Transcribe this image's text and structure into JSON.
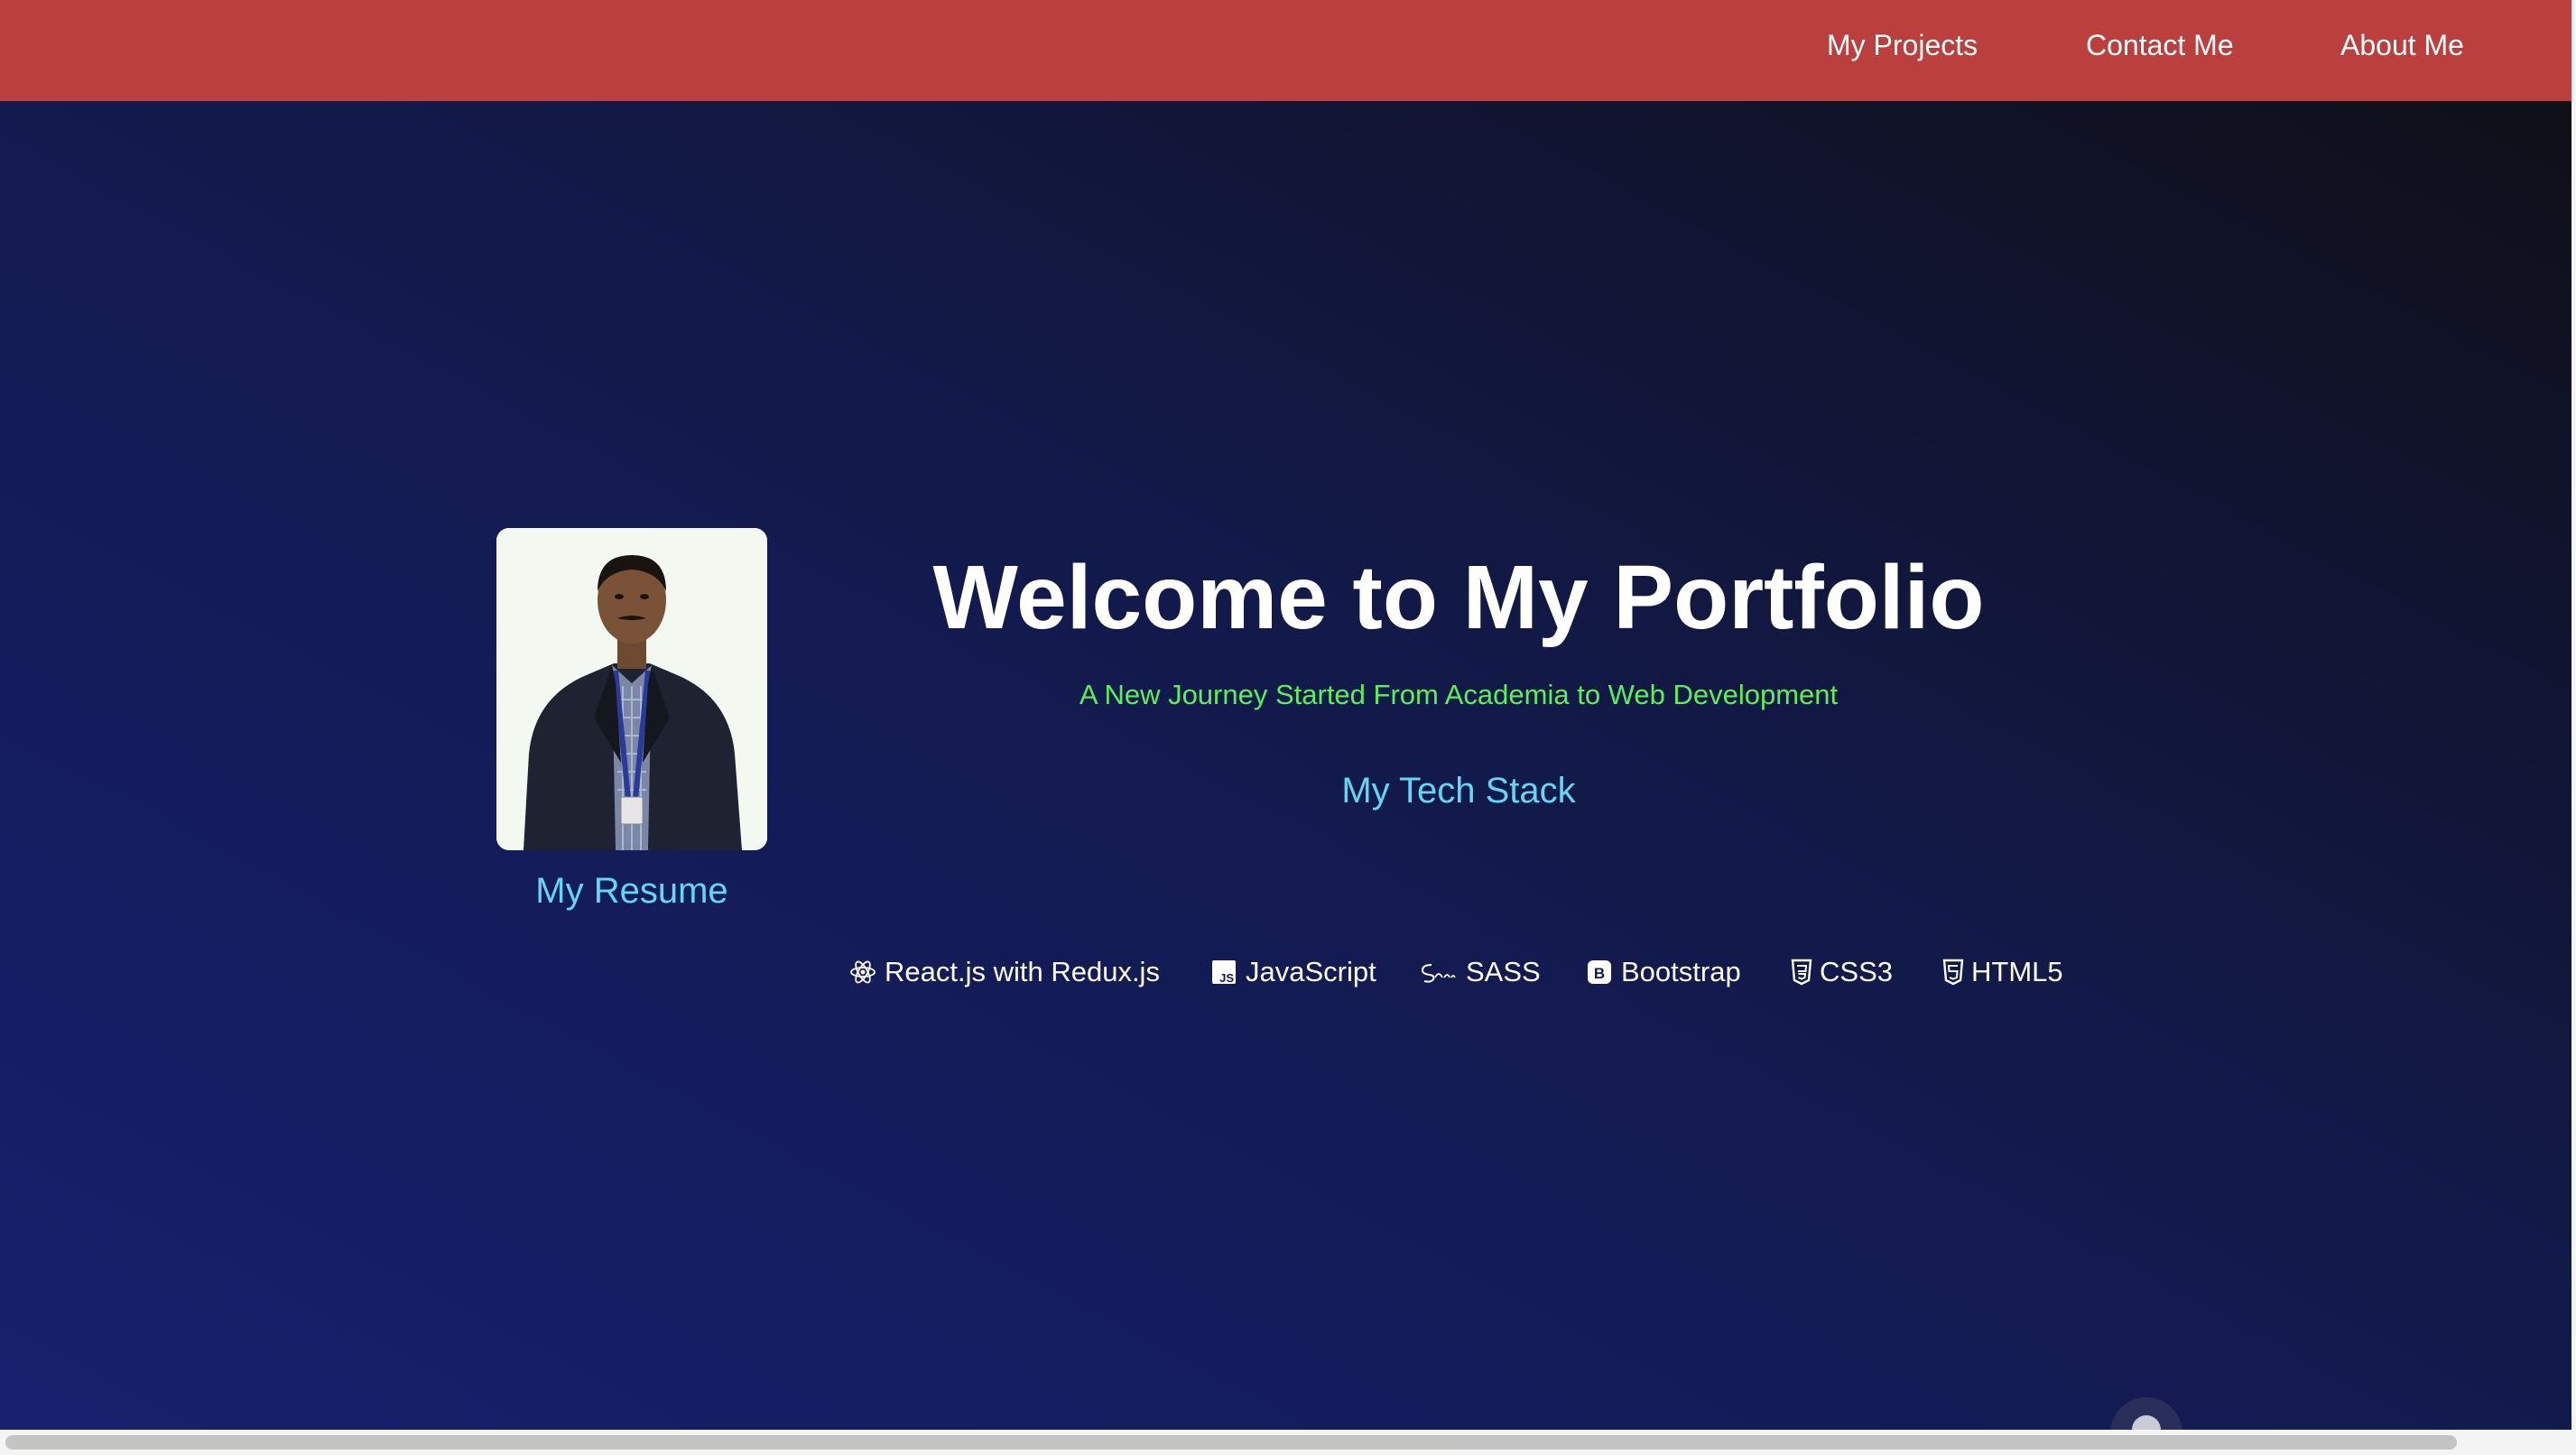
{
  "nav": {
    "links": [
      {
        "label": "My Projects"
      },
      {
        "label": "Contact Me"
      },
      {
        "label": "About Me"
      }
    ]
  },
  "hero": {
    "title": "Welcome to My Portfolio",
    "subtitle": "A New Journey Started From Academia to Web Development",
    "resume_label": "My Resume",
    "photo_alt": "profile-photo"
  },
  "tech_stack": {
    "heading": "My Tech Stack",
    "items": [
      {
        "label": "React.js with Redux.js",
        "icon": "react-icon"
      },
      {
        "label": "JavaScript",
        "icon": "javascript-icon"
      },
      {
        "label": "SASS",
        "icon": "sass-icon"
      },
      {
        "label": "Bootstrap",
        "icon": "bootstrap-icon"
      },
      {
        "label": "CSS3",
        "icon": "css3-icon"
      },
      {
        "label": "HTML5",
        "icon": "html5-icon"
      }
    ]
  },
  "colors": {
    "navbar": "#bb3f3d",
    "hero_gradient_start": "#16206d",
    "hero_gradient_end": "#101018",
    "accent_cyan": "#63d6f2",
    "accent_green": "#59f05a",
    "text_white": "#ffffff"
  }
}
